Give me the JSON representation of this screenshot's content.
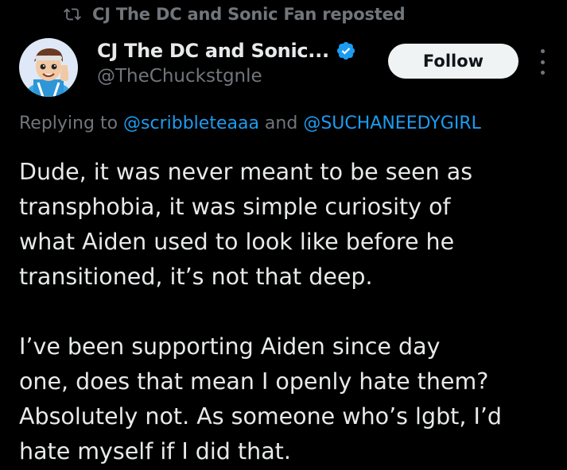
{
  "repost": {
    "icon": "repost-icon",
    "text": "CJ The DC and Sonic Fan reposted"
  },
  "author": {
    "avatar_icon": "avatar",
    "display_name": "CJ The DC and Sonic...",
    "verified_icon": "verified-badge-icon",
    "handle": "@TheChuckstgnle"
  },
  "actions": {
    "follow_label": "Follow",
    "more_icon": "more-options-icon"
  },
  "reply": {
    "prefix": "Replying to ",
    "mention1": "@scribbleteaaa",
    "conj": " and ",
    "mention2": "@SUCHANEEDYGIRL"
  },
  "tweet": {
    "lines_p1": [
      "Dude, it was never meant to be seen as",
      "transphobia, it was simple curiosity of",
      "what Aiden used to look like before he",
      "transitioned, it’s not that deep."
    ],
    "lines_p2": [
      "I’ve been supporting Aiden since day",
      "one, does that mean I openly hate them?",
      "Absolutely not. As someone who’s lgbt, I’d",
      "hate myself if I did that."
    ]
  },
  "colors": {
    "background": "#000000",
    "text_primary": "#e7e9ea",
    "text_secondary": "#71767b",
    "link": "#1d9bf0",
    "follow_bg": "#eff3f4"
  }
}
